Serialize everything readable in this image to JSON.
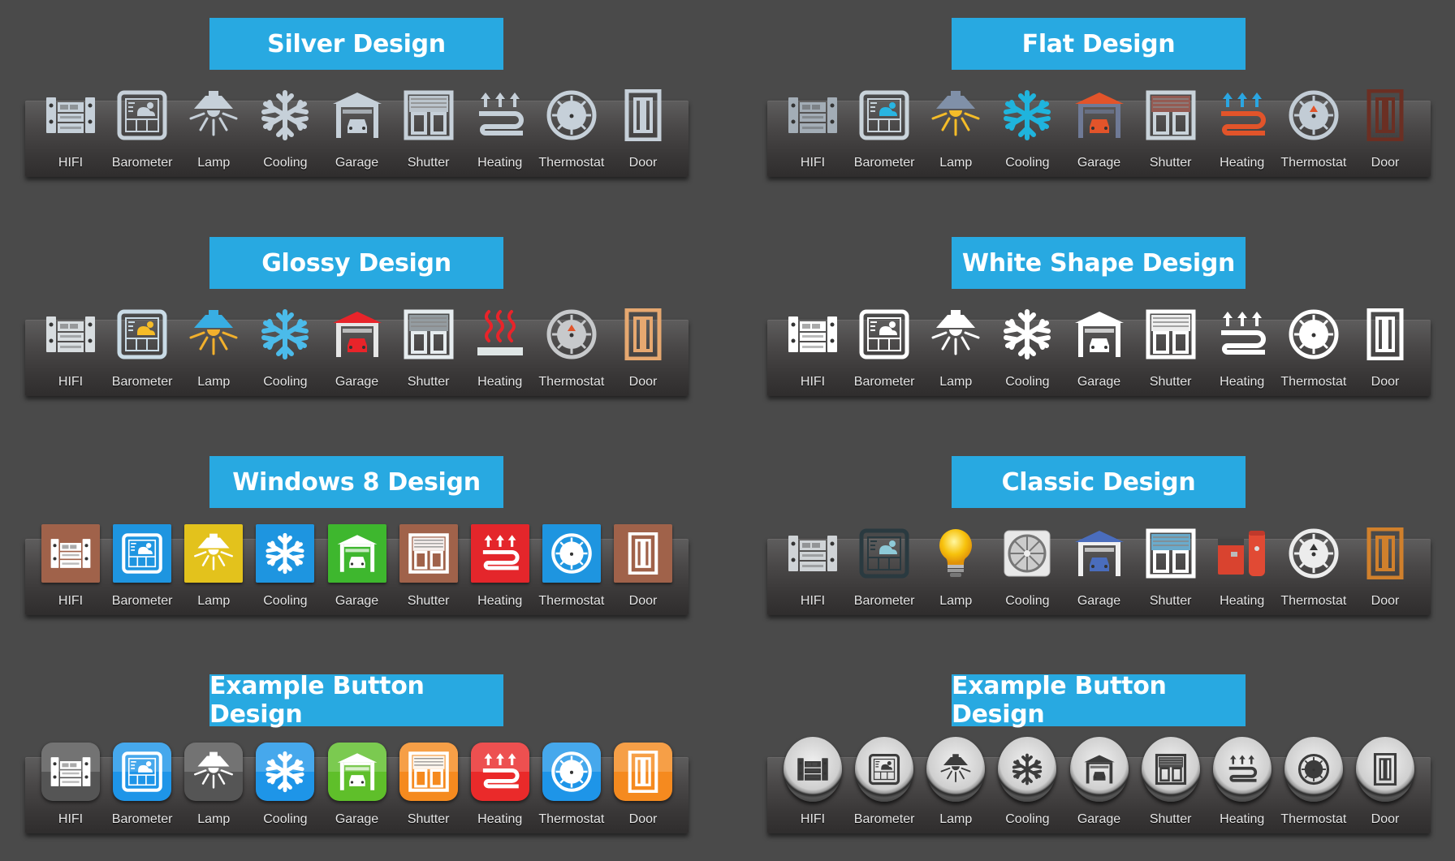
{
  "sets": [
    {
      "id": "silver",
      "title": "Silver Design",
      "style": "silver",
      "items": [
        {
          "label": "HIFI",
          "icon": "hifi-icon"
        },
        {
          "label": "Barometer",
          "icon": "barometer-icon"
        },
        {
          "label": "Lamp",
          "icon": "lamp-icon"
        },
        {
          "label": "Cooling",
          "icon": "snowflake-icon"
        },
        {
          "label": "Garage",
          "icon": "garage-icon"
        },
        {
          "label": "Shutter",
          "icon": "shutter-icon"
        },
        {
          "label": "Heating",
          "icon": "heating-icon"
        },
        {
          "label": "Thermostat",
          "icon": "thermostat-icon"
        },
        {
          "label": "Door",
          "icon": "door-icon"
        }
      ]
    },
    {
      "id": "flat",
      "title": "Flat Design",
      "style": "flat",
      "items": [
        {
          "label": "HIFI",
          "icon": "hifi-icon"
        },
        {
          "label": "Barometer",
          "icon": "barometer-icon"
        },
        {
          "label": "Lamp",
          "icon": "lamp-icon"
        },
        {
          "label": "Cooling",
          "icon": "snowflake-icon"
        },
        {
          "label": "Garage",
          "icon": "garage-icon"
        },
        {
          "label": "Shutter",
          "icon": "shutter-icon"
        },
        {
          "label": "Heating",
          "icon": "heating-icon"
        },
        {
          "label": "Thermostat",
          "icon": "thermostat-icon"
        },
        {
          "label": "Door",
          "icon": "door-icon"
        }
      ]
    },
    {
      "id": "glossy",
      "title": "Glossy Design",
      "style": "glossy",
      "items": [
        {
          "label": "HIFI",
          "icon": "hifi-icon"
        },
        {
          "label": "Barometer",
          "icon": "barometer-icon"
        },
        {
          "label": "Lamp",
          "icon": "lamp-icon"
        },
        {
          "label": "Cooling",
          "icon": "snowflake-icon"
        },
        {
          "label": "Garage",
          "icon": "garage-icon"
        },
        {
          "label": "Shutter",
          "icon": "shutter-icon"
        },
        {
          "label": "Heating",
          "icon": "heat-waves-icon"
        },
        {
          "label": "Thermostat",
          "icon": "thermostat-icon"
        },
        {
          "label": "Door",
          "icon": "door-icon"
        }
      ]
    },
    {
      "id": "white-shape",
      "title": "White Shape Design",
      "style": "white",
      "items": [
        {
          "label": "HIFI",
          "icon": "hifi-icon"
        },
        {
          "label": "Barometer",
          "icon": "barometer-icon"
        },
        {
          "label": "Lamp",
          "icon": "lamp-icon"
        },
        {
          "label": "Cooling",
          "icon": "snowflake-icon"
        },
        {
          "label": "Garage",
          "icon": "garage-icon"
        },
        {
          "label": "Shutter",
          "icon": "shutter-icon"
        },
        {
          "label": "Heating",
          "icon": "heating-icon"
        },
        {
          "label": "Thermostat",
          "icon": "thermostat-icon"
        },
        {
          "label": "Door",
          "icon": "door-icon"
        }
      ]
    },
    {
      "id": "windows8",
      "title": "Windows 8 Design",
      "style": "tile",
      "items": [
        {
          "label": "HIFI",
          "icon": "hifi-icon",
          "color": "#a0624a"
        },
        {
          "label": "Barometer",
          "icon": "barometer-icon",
          "color": "#1e95e0"
        },
        {
          "label": "Lamp",
          "icon": "lamp-icon",
          "color": "#e3c21c"
        },
        {
          "label": "Cooling",
          "icon": "snowflake-icon",
          "color": "#1e95e0"
        },
        {
          "label": "Garage",
          "icon": "garage-icon",
          "color": "#3eb72e"
        },
        {
          "label": "Shutter",
          "icon": "shutter-icon",
          "color": "#a0624a"
        },
        {
          "label": "Heating",
          "icon": "heating-icon",
          "color": "#e4262b"
        },
        {
          "label": "Thermostat",
          "icon": "thermostat-icon",
          "color": "#1e95e0"
        },
        {
          "label": "Door",
          "icon": "door-icon",
          "color": "#a0624a"
        }
      ]
    },
    {
      "id": "classic",
      "title": "Classic Design",
      "style": "classic",
      "items": [
        {
          "label": "HIFI",
          "icon": "hifi-icon"
        },
        {
          "label": "Barometer",
          "icon": "barometer-icon"
        },
        {
          "label": "Lamp",
          "icon": "lightbulb-icon"
        },
        {
          "label": "Cooling",
          "icon": "fan-icon"
        },
        {
          "label": "Garage",
          "icon": "garage-icon"
        },
        {
          "label": "Shutter",
          "icon": "shutter-icon"
        },
        {
          "label": "Heating",
          "icon": "boiler-icon"
        },
        {
          "label": "Thermostat",
          "icon": "thermostat-icon"
        },
        {
          "label": "Door",
          "icon": "door-icon"
        }
      ]
    },
    {
      "id": "example-button-app",
      "title": "Example Button Design",
      "style": "app",
      "items": [
        {
          "label": "HIFI",
          "icon": "hifi-icon",
          "color": "#555555"
        },
        {
          "label": "Barometer",
          "icon": "barometer-icon",
          "color": "#1e95e8"
        },
        {
          "label": "Lamp",
          "icon": "lamp-icon",
          "color": "#555555"
        },
        {
          "label": "Cooling",
          "icon": "snowflake-icon",
          "color": "#1e95e8"
        },
        {
          "label": "Garage",
          "icon": "garage-icon",
          "color": "#5fbf2a"
        },
        {
          "label": "Shutter",
          "icon": "shutter-icon",
          "color": "#f58a1f"
        },
        {
          "label": "Heating",
          "icon": "heating-icon",
          "color": "#ea2a2a"
        },
        {
          "label": "Thermostat",
          "icon": "thermostat-icon",
          "color": "#1e95e8"
        },
        {
          "label": "Door",
          "icon": "door-icon",
          "color": "#f58a1f"
        }
      ]
    },
    {
      "id": "example-button-round",
      "title": "Example Button Design",
      "style": "round",
      "items": [
        {
          "label": "HIFI",
          "icon": "hifi-icon"
        },
        {
          "label": "Barometer",
          "icon": "barometer-icon"
        },
        {
          "label": "Lamp",
          "icon": "lamp-icon"
        },
        {
          "label": "Cooling",
          "icon": "snowflake-icon"
        },
        {
          "label": "Garage",
          "icon": "garage-icon"
        },
        {
          "label": "Shutter",
          "icon": "shutter-icon"
        },
        {
          "label": "Heating",
          "icon": "heating-icon"
        },
        {
          "label": "Thermostat",
          "icon": "thermostat-icon"
        },
        {
          "label": "Door",
          "icon": "door-icon"
        }
      ]
    }
  ],
  "colors": {
    "title_bg": "#28a9e1",
    "background": "#4a4a4a",
    "label": "#e6e6e6"
  }
}
